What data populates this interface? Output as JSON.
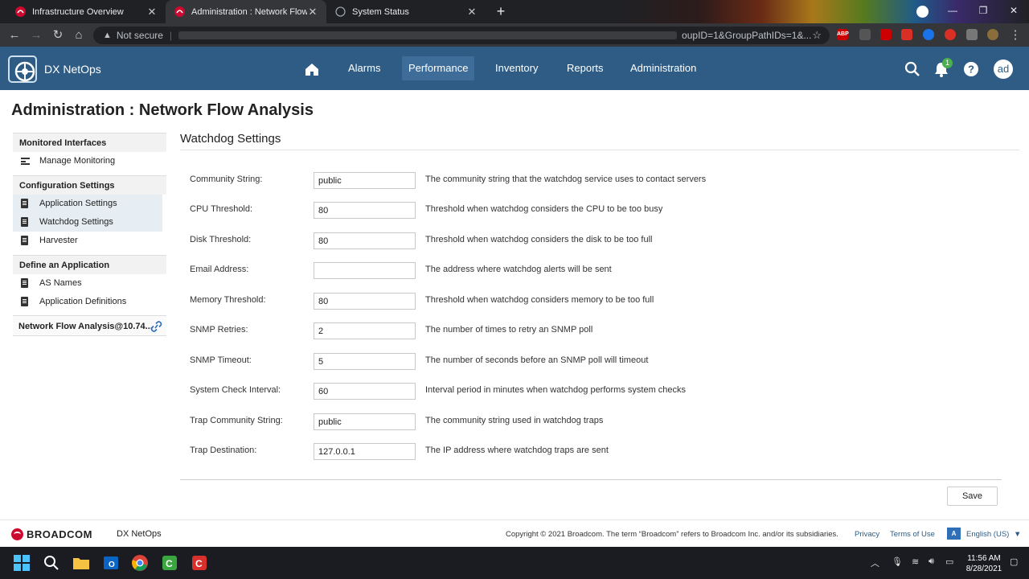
{
  "browser": {
    "tabs": [
      {
        "title": "Infrastructure Overview",
        "active": false
      },
      {
        "title": "Administration : Network Flow Analysis",
        "active": true
      },
      {
        "title": "System Status",
        "active": false
      }
    ],
    "address": {
      "security_label": "Not secure",
      "url_tail": "oupID=1&GroupPathIDs=1&..."
    },
    "extensions": [
      "ABP"
    ]
  },
  "app": {
    "name": "DX NetOps",
    "nav": [
      {
        "label": "Alarms",
        "active": false
      },
      {
        "label": "Performance",
        "active": true
      },
      {
        "label": "Inventory",
        "active": false
      },
      {
        "label": "Reports",
        "active": false
      },
      {
        "label": "Administration",
        "active": false
      }
    ],
    "notifications_count": "1",
    "avatar_initials": "ad"
  },
  "page": {
    "title": "Administration : Network Flow Analysis"
  },
  "sidebar": {
    "sections": [
      {
        "heading": "Monitored Interfaces",
        "items": [
          {
            "label": "Manage Monitoring",
            "icon": "list-icon",
            "highlighted": false
          }
        ]
      },
      {
        "heading": "Configuration Settings",
        "items": [
          {
            "label": "Application Settings",
            "icon": "document-icon",
            "highlighted": true
          },
          {
            "label": "Watchdog Settings",
            "icon": "document-icon",
            "highlighted": true
          },
          {
            "label": "Harvester",
            "icon": "document-icon",
            "highlighted": false
          }
        ]
      },
      {
        "heading": "Define an Application",
        "items": [
          {
            "label": "AS Names",
            "icon": "document-icon",
            "highlighted": false
          },
          {
            "label": "Application Definitions",
            "icon": "document-icon",
            "highlighted": false
          }
        ]
      }
    ],
    "data_source_link": "Network Flow Analysis@10.74..."
  },
  "content": {
    "title": "Watchdog Settings",
    "fields": [
      {
        "label": "Community String:",
        "value": "public",
        "description": "The community string that the watchdog service uses to contact servers"
      },
      {
        "label": "CPU Threshold:",
        "value": "80",
        "description": "Threshold when watchdog considers the CPU to be too busy"
      },
      {
        "label": "Disk Threshold:",
        "value": "80",
        "description": "Threshold when watchdog considers the disk to be too full"
      },
      {
        "label": "Email Address:",
        "value": "",
        "description": "The address where watchdog alerts will be sent"
      },
      {
        "label": "Memory Threshold:",
        "value": "80",
        "description": "Threshold when watchdog considers memory to be too full"
      },
      {
        "label": "SNMP Retries:",
        "value": "2",
        "description": "The number of times to retry an SNMP poll"
      },
      {
        "label": "SNMP Timeout:",
        "value": "5",
        "description": "The number of seconds before an SNMP poll will timeout"
      },
      {
        "label": "System Check Interval:",
        "value": "60",
        "description": "Interval period in minutes when watchdog performs system checks"
      },
      {
        "label": "Trap Community String:",
        "value": "public",
        "description": "The community string used in watchdog traps"
      },
      {
        "label": "Trap Destination:",
        "value": "127.0.0.1",
        "description": "The IP address where watchdog traps are sent"
      }
    ],
    "save_label": "Save"
  },
  "footer": {
    "brand": "BROADCOM",
    "product": "DX NetOps",
    "copyright": "Copyright © 2021 Broadcom. The term “Broadcom” refers to Broadcom Inc. and/or its subsidiaries.",
    "privacy": "Privacy",
    "terms": "Terms of Use",
    "language": "English (US)"
  },
  "taskbar": {
    "time": "11:56 AM",
    "date": "8/28/2021"
  },
  "colors": {
    "header_bg": "#2e5c85",
    "nav_active": "#3d6d98",
    "sidebar_highlight": "#e6edf3",
    "notification_badge": "#4caf50",
    "broadcom_red": "#cc092f"
  }
}
